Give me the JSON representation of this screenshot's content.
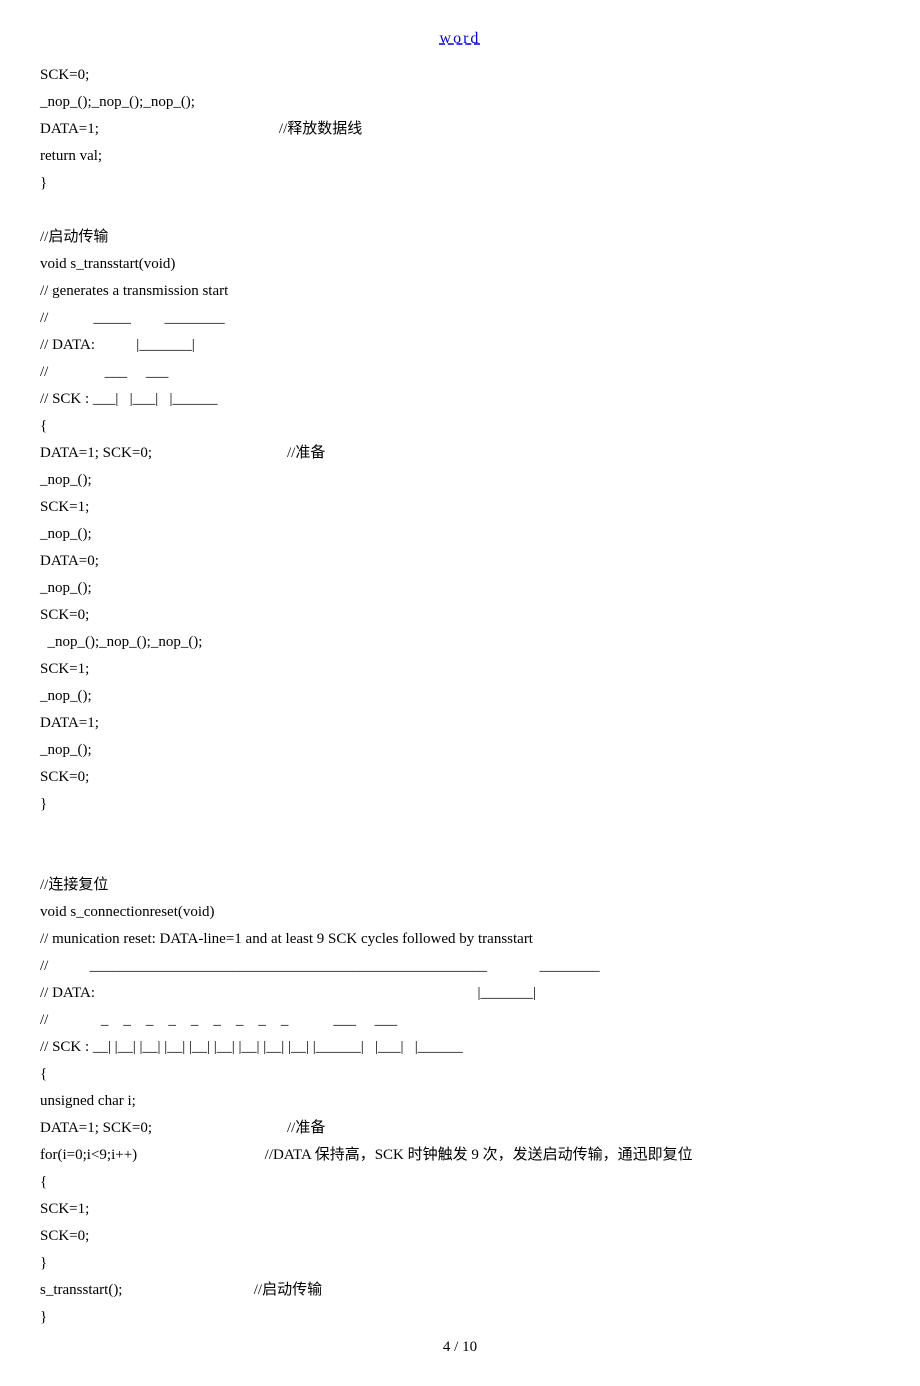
{
  "header": "word",
  "lines": [
    "SCK=0;",
    "_nop_();_nop_();_nop_();",
    "DATA=1;                                                //释放数据线",
    "return val;",
    "}",
    "",
    "//启动传输",
    "void s_transstart(void)",
    "// generates a transmission start",
    "//            _____         ________",
    "// DATA:           |_______|",
    "//               ___     ___",
    "// SCK : ___|   |___|   |______",
    "{",
    "DATA=1; SCK=0;                                    //准备",
    "_nop_();",
    "SCK=1;",
    "_nop_();",
    "DATA=0;",
    "_nop_();",
    "SCK=0;",
    "  _nop_();_nop_();_nop_();",
    "SCK=1;",
    "_nop_();",
    "DATA=1;",
    "_nop_();",
    "SCK=0;",
    "}",
    "",
    "",
    "//连接复位",
    "void s_connectionreset(void)",
    "// munication reset: DATA-line=1 and at least 9 SCK cycles followed by transstart",
    "//           _____________________________________________________              ________",
    "// DATA:                                                                                                      |_______|",
    "//              _    _    _    _    _    _    _    _    _            ___     ___",
    "// SCK : __| |__| |__| |__| |__| |__| |__| |__| |__| |______|   |___|   |______",
    "{",
    "unsigned char i;",
    "DATA=1; SCK=0;                                    //准备",
    "for(i=0;i<9;i++)                                  //DATA 保持高，SCK 时钟触发 9 次，发送启动传输，通迅即复位",
    "{",
    "SCK=1;",
    "SCK=0;",
    "}",
    "s_transstart();                                   //启动传输",
    "}"
  ],
  "footer": "4  / 10"
}
